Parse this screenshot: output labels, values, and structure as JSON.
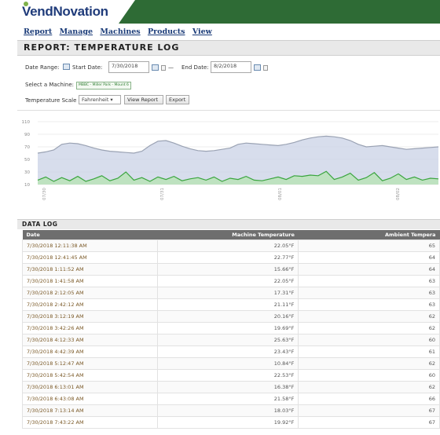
{
  "brand": {
    "part1": "Vend",
    "part2": "Novation"
  },
  "menu": [
    "Report",
    "Manage",
    "Machines",
    "Products",
    "View"
  ],
  "report_title": "REPORT: TEMPERATURE LOG",
  "filters": {
    "date_range_label": "Date Range:",
    "start_date_label": "Start Date:",
    "start_date": "7/30/2018",
    "dash": "—",
    "end_date_label": "End Date:",
    "end_date": "8/2/2018",
    "machine_label": "Select a Machine:",
    "machine_value": "MBBC - Miller Park - Mount 6",
    "scale_label": "Temperature Scale",
    "scale_value": "Fahrenheit ▾",
    "view_report": "View Report",
    "export": "Export"
  },
  "chart_data": {
    "type": "area",
    "yticks": [
      10,
      30,
      50,
      70,
      90,
      110
    ],
    "ylim": [
      10,
      110
    ],
    "xticks": [
      "07/30",
      "07/31",
      "08/01",
      "08/02"
    ],
    "series": [
      {
        "color": "#c9d2e6",
        "line": "#9aa2b3",
        "values": [
          60,
          62,
          65,
          74,
          76,
          75,
          72,
          68,
          65,
          63,
          62,
          61,
          60,
          63,
          72,
          79,
          80,
          76,
          71,
          67,
          64,
          63,
          64,
          66,
          68,
          74,
          76,
          75,
          74,
          73,
          72,
          74,
          77,
          81,
          84,
          86,
          87,
          86,
          84,
          80,
          74,
          70,
          71,
          72,
          70,
          68,
          66,
          67,
          68,
          69,
          70
        ]
      },
      {
        "color": "#b6e3b2",
        "line": "#3aa53e",
        "values": [
          17,
          22,
          15,
          21,
          16,
          23,
          15,
          19,
          24,
          16,
          20,
          30,
          17,
          21,
          15,
          22,
          18,
          23,
          16,
          19,
          21,
          17,
          22,
          15,
          20,
          18,
          23,
          17,
          16,
          19,
          22,
          18,
          24,
          23,
          25,
          24,
          31,
          18,
          22,
          28,
          17,
          21,
          29,
          16,
          20,
          27,
          18,
          22,
          17,
          20,
          19
        ]
      }
    ]
  },
  "datalog_title": "DATA LOG",
  "table": {
    "headers": [
      "Date",
      "Machine Temperature",
      "Ambient Tempera"
    ],
    "rows": [
      [
        "7/30/2018 12:11:38 AM",
        "22.05°F",
        "65"
      ],
      [
        "7/30/2018 12:41:45 AM",
        "22.77°F",
        "64"
      ],
      [
        "7/30/2018 1:11:52 AM",
        "15.66°F",
        "64"
      ],
      [
        "7/30/2018 1:41:58 AM",
        "22.05°F",
        "63"
      ],
      [
        "7/30/2018 2:12:05 AM",
        "17.31°F",
        "63"
      ],
      [
        "7/30/2018 2:42:12 AM",
        "21.11°F",
        "63"
      ],
      [
        "7/30/2018 3:12:19 AM",
        "20.16°F",
        "62"
      ],
      [
        "7/30/2018 3:42:26 AM",
        "19.69°F",
        "62"
      ],
      [
        "7/30/2018 4:12:33 AM",
        "25.63°F",
        "60"
      ],
      [
        "7/30/2018 4:42:39 AM",
        "23.43°F",
        "61"
      ],
      [
        "7/30/2018 5:12:47 AM",
        "10.84°F",
        "62"
      ],
      [
        "7/30/2018 5:42:54 AM",
        "22.53°F",
        "60"
      ],
      [
        "7/30/2018 6:13:01 AM",
        "16.38°F",
        "62"
      ],
      [
        "7/30/2018 6:43:08 AM",
        "21.58°F",
        "66"
      ],
      [
        "7/30/2018 7:13:14 AM",
        "18.03°F",
        "67"
      ],
      [
        "7/30/2018 7:43:22 AM",
        "19.92°F",
        "67"
      ]
    ]
  }
}
